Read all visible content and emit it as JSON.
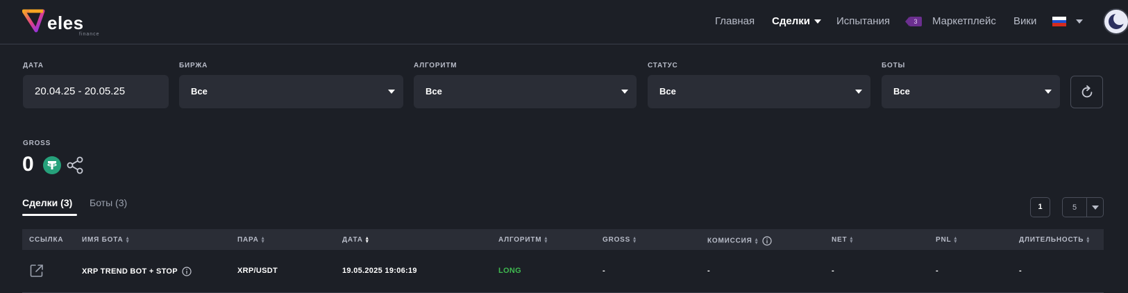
{
  "header": {
    "logo_text": "eles",
    "logo_sub": "finance",
    "nav": {
      "home": "Главная",
      "deals": "Сделки",
      "tests": "Испытания",
      "tests_badge": "3",
      "marketplace": "Маркетплейс",
      "wiki": "Вики"
    },
    "language": "ru"
  },
  "filters": {
    "date": {
      "label": "ДАТА",
      "value": "20.04.25 - 20.05.25"
    },
    "exchange": {
      "label": "БИРЖА",
      "value": "Все"
    },
    "algorithm": {
      "label": "АЛГОРИТМ",
      "value": "Все"
    },
    "status": {
      "label": "СТАТУС",
      "value": "Все"
    },
    "bots": {
      "label": "БОТЫ",
      "value": "Все"
    }
  },
  "gross": {
    "label": "GROSS",
    "value": "0"
  },
  "tabs": [
    {
      "label": "Сделки (3)",
      "active": true
    },
    {
      "label": "Боты (3)",
      "active": false
    }
  ],
  "pagination": {
    "page": "1",
    "per_page": "5"
  },
  "table": {
    "columns": {
      "link": "ССЫЛКА",
      "bot_name": "ИМЯ БОТА",
      "pair": "ПАРА",
      "date": "ДАТА",
      "algorithm": "АЛГОРИТМ",
      "gross": "GROSS",
      "commission": "КОМИССИЯ",
      "net": "NET",
      "pnl": "PNL",
      "duration": "ДЛИТЕЛЬНОСТЬ"
    },
    "rows": [
      {
        "bot_name": "XRP TREND BOT + STOP",
        "pair": "XRP/USDT",
        "date": "19.05.2025 19:06:19",
        "algorithm": "LONG",
        "gross": "-",
        "commission": "-",
        "net": "-",
        "pnl": "-",
        "duration": "-"
      }
    ]
  },
  "colors": {
    "background": "#1c1f26",
    "panel": "#2a2d36",
    "long": "#3fb950",
    "badge": "#6b2f8f",
    "usdt": "#26a17b"
  }
}
